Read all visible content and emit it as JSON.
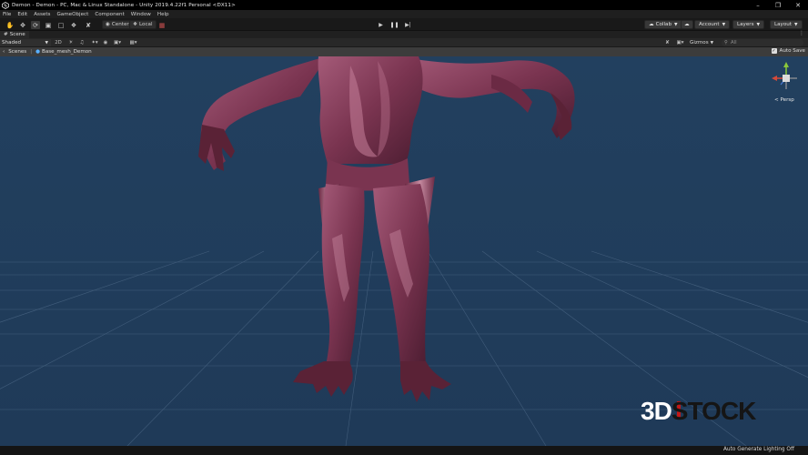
{
  "window": {
    "title": "Demon - Demon - PC, Mac & Linux Standalone - Unity 2019.4.22f1 Personal <DX11>"
  },
  "menu": {
    "items": [
      "File",
      "Edit",
      "Assets",
      "GameObject",
      "Component",
      "Window",
      "Help"
    ]
  },
  "toolbar": {
    "pivot_center": "Center",
    "pivot_local": "Local",
    "collab": "Collab",
    "account": "Account",
    "layers": "Layers",
    "layout": "Layout"
  },
  "scene_tab": {
    "label": "Scene"
  },
  "scene_toolbar": {
    "shading_mode": "Shaded",
    "view_2d": "2D",
    "gizmos": "Gizmos",
    "search_placeholder": "All"
  },
  "breadcrumb": {
    "root": "Scenes",
    "current": "Base_mesh_Demon"
  },
  "auto_save": {
    "label": "Auto Save",
    "checked": true
  },
  "viewport": {
    "projection_label": "< Persp",
    "background_color": "#223c5a"
  },
  "watermark": {
    "part1": "3D",
    "part2": "STOCK"
  },
  "status": {
    "lighting": "Auto Generate Lighting Off"
  }
}
